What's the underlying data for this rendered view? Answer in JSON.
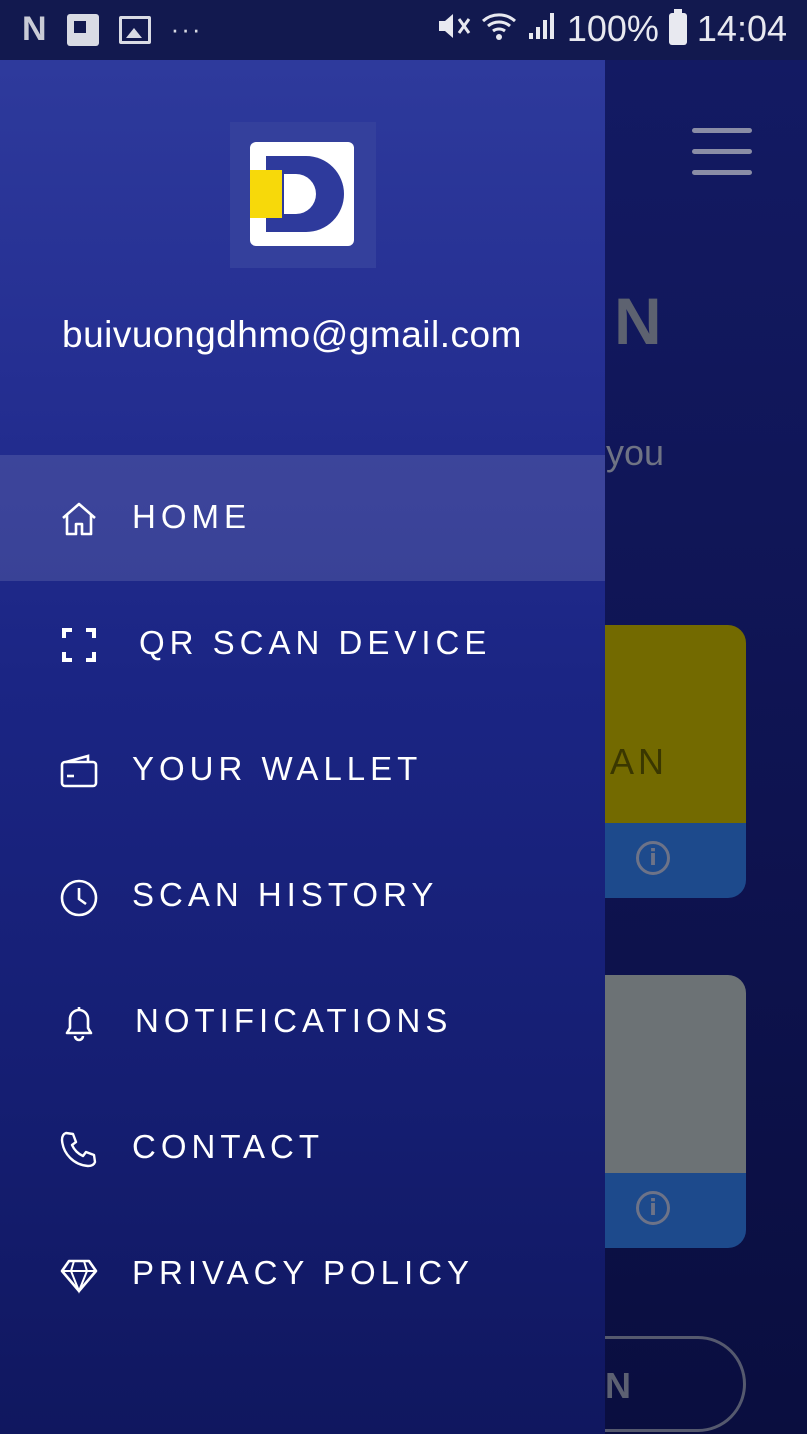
{
  "status_bar": {
    "left_icons": [
      "n-icon",
      "flipboard-icon",
      "image-icon",
      "more-dots-icon"
    ],
    "n_glyph": "N",
    "dots": "···",
    "battery_percent": "100%",
    "time": "14:04"
  },
  "drawer": {
    "email": "buivuongdhmo@gmail.com",
    "items": [
      {
        "label": "HOME",
        "icon": "home-icon",
        "active": true
      },
      {
        "label": "QR SCAN DEVICE",
        "icon": "qr-scan-icon",
        "active": false
      },
      {
        "label": "YOUR WALLET",
        "icon": "wallet-icon",
        "active": false
      },
      {
        "label": "SCAN HISTORY",
        "icon": "clock-icon",
        "active": false
      },
      {
        "label": "NOTIFICATIONS",
        "icon": "bell-icon",
        "active": false
      },
      {
        "label": "CONTACT",
        "icon": "phone-icon",
        "active": false
      },
      {
        "label": "PRIVACY POLICY",
        "icon": "diamond-icon",
        "active": false
      }
    ]
  },
  "background": {
    "title_fragment": "N",
    "subtitle_fragment": "you",
    "card1_fragment": "AN",
    "button_fragment": "N"
  },
  "colors": {
    "drawer_top": "#2e3a9c",
    "drawer_bottom": "#10175f",
    "logo_yellow": "#f7d90a",
    "card_yellow": "#736a00",
    "card_blue": "#1d4a8c"
  }
}
